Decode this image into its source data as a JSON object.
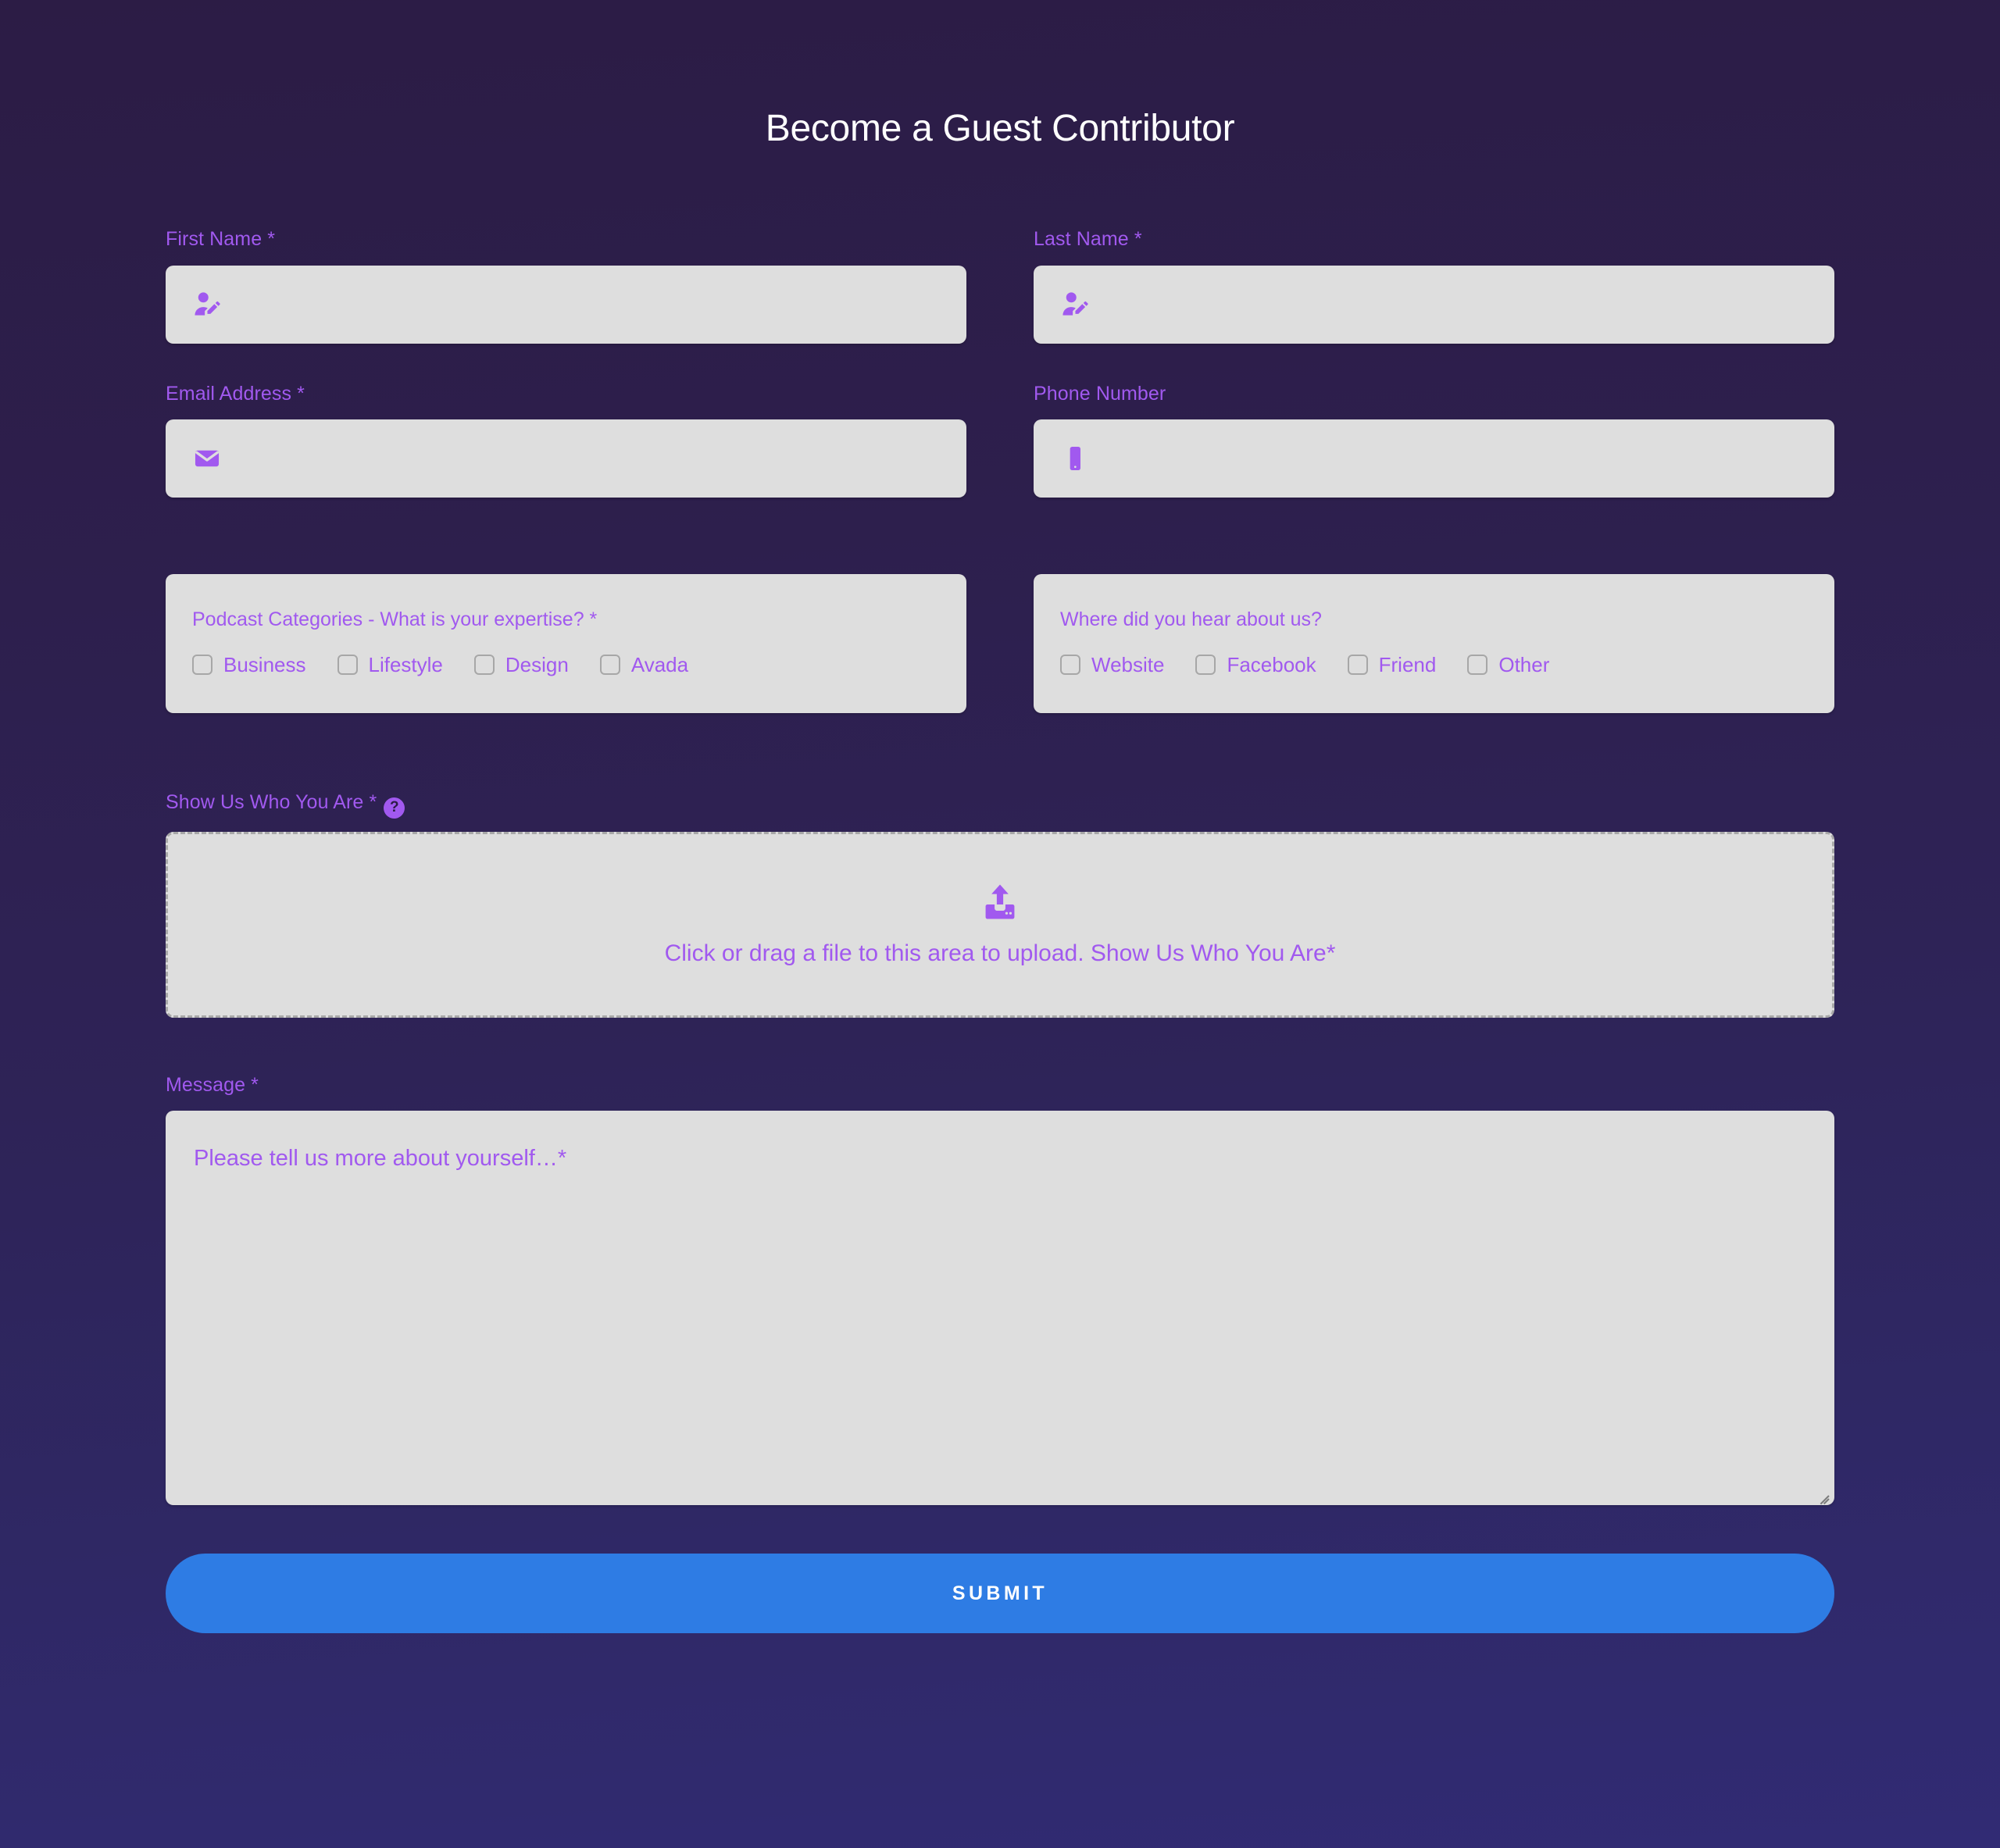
{
  "form": {
    "title": "Become a Guest Contributor",
    "accent_purple": "#a159ef",
    "field_bg": "#dedede",
    "submit_color": "#2e7ce4",
    "bg_top": "#2c1c45",
    "bg_bottom": "#312b74"
  },
  "fields": {
    "first_name": {
      "label": "First Name *",
      "value": "",
      "placeholder": "",
      "icon": "user-edit-icon"
    },
    "last_name": {
      "label": "Last Name *",
      "value": "",
      "placeholder": "",
      "icon": "user-edit-icon"
    },
    "email": {
      "label": "Email Address *",
      "value": "",
      "placeholder": "",
      "icon": "envelope-icon"
    },
    "phone": {
      "label": "Phone Number",
      "value": "",
      "placeholder": "",
      "icon": "mobile-phone-icon"
    }
  },
  "categories": {
    "legend": "Podcast Categories - What is your expertise? *",
    "options": [
      {
        "label": "Business",
        "checked": false
      },
      {
        "label": "Lifestyle",
        "checked": false
      },
      {
        "label": "Design",
        "checked": false
      },
      {
        "label": "Avada",
        "checked": false
      }
    ]
  },
  "referral": {
    "legend": "Where did you hear about us?",
    "options": [
      {
        "label": "Website",
        "checked": false
      },
      {
        "label": "Facebook",
        "checked": false
      },
      {
        "label": "Friend",
        "checked": false
      },
      {
        "label": "Other",
        "checked": false
      }
    ]
  },
  "upload": {
    "label": "Show Us Who You Are *",
    "help_glyph": "?",
    "icon": "upload-arrow-icon",
    "drop_text": "Click or drag a file to this area to upload. Show Us Who You Are*"
  },
  "message": {
    "label": "Message *",
    "value": "",
    "placeholder": "Please tell us more about yourself…*"
  },
  "submit": {
    "label": "SUBMIT"
  }
}
